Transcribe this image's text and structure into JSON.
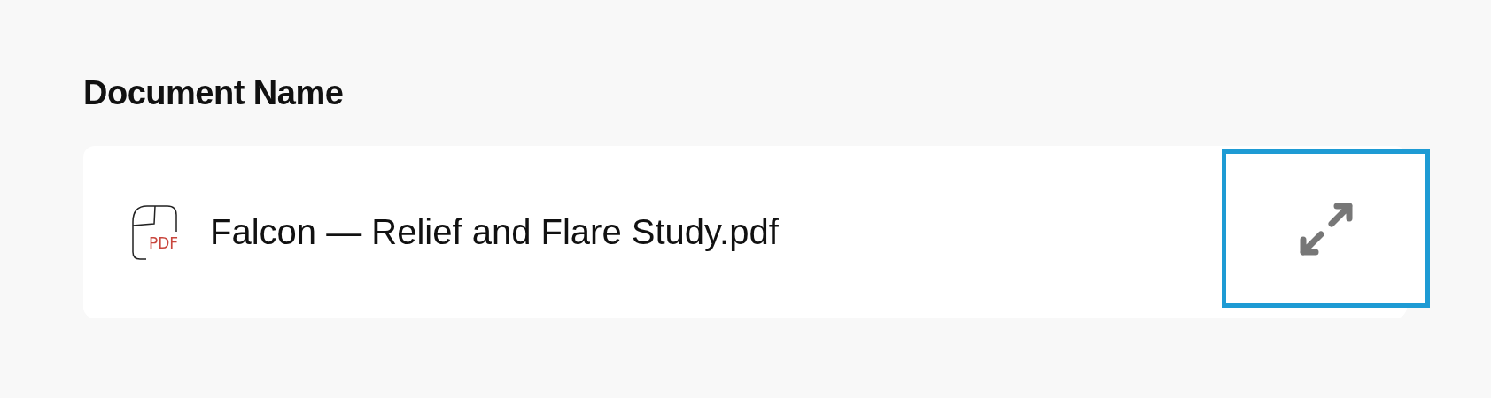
{
  "heading": "Document Name",
  "document": {
    "file_type": "PDF",
    "name": "Falcon — Relief and Flare Study.pdf"
  },
  "expand_button": {
    "focused": true
  }
}
